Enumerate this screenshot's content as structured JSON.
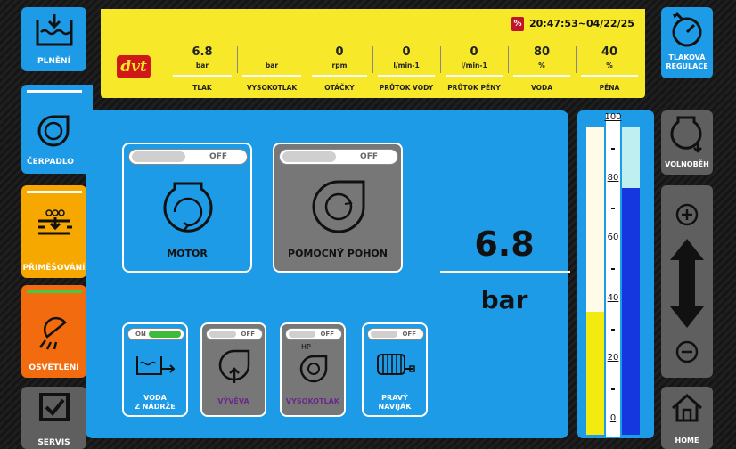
{
  "status": {
    "datetime": "20:47:53~04/22/25",
    "badge": "%"
  },
  "logo_text": "dvt",
  "readouts": [
    {
      "value": "6.8",
      "unit": "bar",
      "name": "TLAK"
    },
    {
      "value": "",
      "unit": "bar",
      "name": "VYSOKOTLAK"
    },
    {
      "value": "0",
      "unit": "rpm",
      "name": "OTÁČKY"
    },
    {
      "value": "0",
      "unit": "l/min-1",
      "name": "PRŮTOK VODY"
    },
    {
      "value": "0",
      "unit": "l/min-1",
      "name": "PRŮTOK PĚNY"
    },
    {
      "value": "80",
      "unit": "%",
      "name": "VODA"
    },
    {
      "value": "40",
      "unit": "%",
      "name": "PĚNA"
    }
  ],
  "left_nav": {
    "plneni": "PLNĚNÍ",
    "cerpadlo": "ČERPADLO",
    "primesovani": "PŘIMĚŠOVÁNÍ",
    "osvetleni": "OSVĚTLENÍ",
    "servis": "SERVIS"
  },
  "right_nav": {
    "tlakova": "TLAKOVÁ",
    "regulace": "REGULACE",
    "volnobeh": "VOLNOBĚH",
    "home": "HOME"
  },
  "motor": {
    "label": "MOTOR",
    "toggle": "OFF"
  },
  "pohon": {
    "label": "POMOCNÝ POHON",
    "toggle": "OFF"
  },
  "pressure": {
    "value": "6.8",
    "unit": "bar"
  },
  "small": [
    {
      "line1": "VODA",
      "line2": "Z NÁDRŽE",
      "toggle": "ON",
      "state": "on"
    },
    {
      "line1": "VÝVĚVA",
      "line2": "",
      "toggle": "OFF",
      "state": "off"
    },
    {
      "line1": "VYSOKOTLAK",
      "line2": "",
      "toggle": "OFF",
      "state": "off",
      "icon_text": "HP"
    },
    {
      "line1": "PRAVÝ",
      "line2": "NAVIJÁK",
      "toggle": "OFF",
      "state": "off"
    }
  ],
  "gauge": {
    "ticks": [
      "100",
      "80",
      "60",
      "40",
      "20",
      "0"
    ],
    "water_level": 80,
    "foam_level": 40,
    "colors": {
      "water": "#1437e0",
      "foam": "#f3ea10"
    }
  }
}
